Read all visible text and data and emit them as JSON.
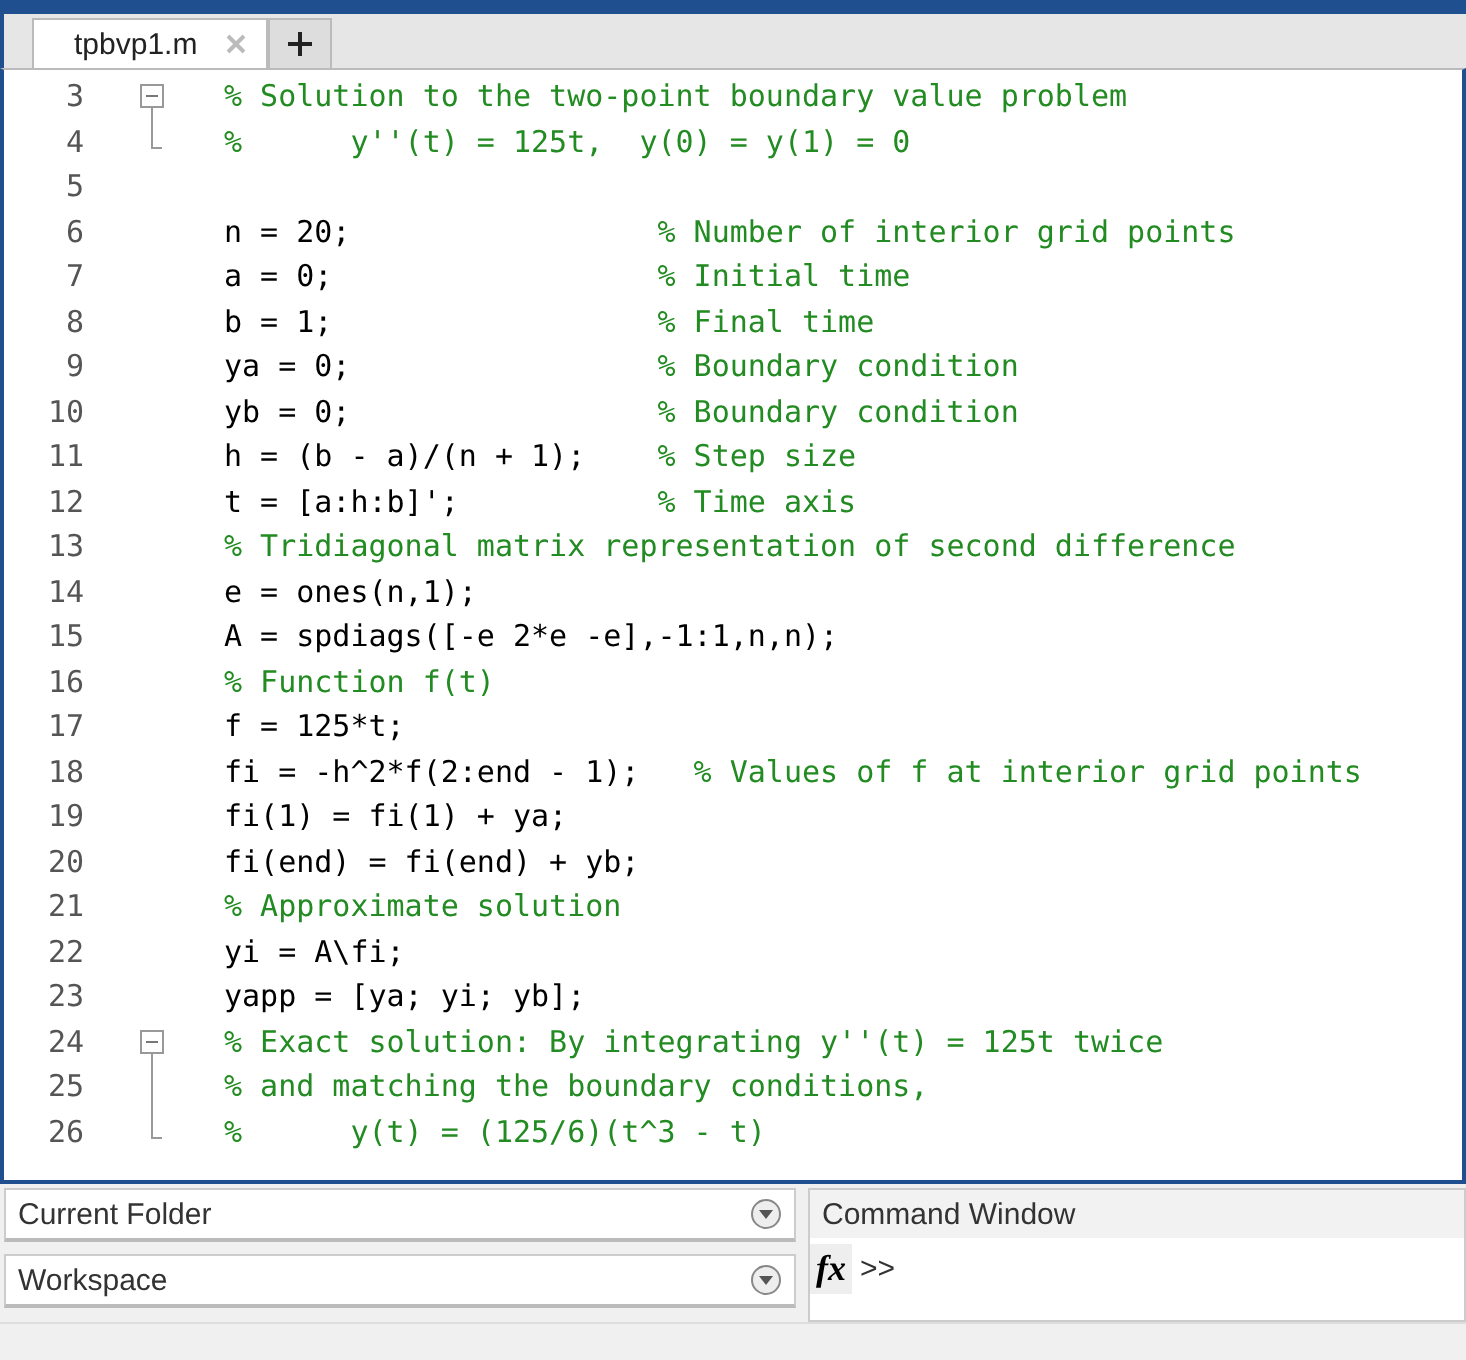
{
  "tabs": [
    {
      "label": "tpbvp1.m",
      "selected": true
    }
  ],
  "editor": {
    "lines": [
      {
        "number": "3",
        "kind": "fold_start",
        "comment": "% Solution to the two-point boundary value problem"
      },
      {
        "number": "4",
        "kind": "fold_end",
        "comment": "%      y''(t) = 125t,  y(0) = y(1) = 0"
      },
      {
        "number": "5"
      },
      {
        "number": "6",
        "code": "n = 20;",
        "comment": "% Number of interior grid points"
      },
      {
        "number": "7",
        "code": "a = 0;",
        "comment": "% Initial time"
      },
      {
        "number": "8",
        "code": "b = 1;",
        "comment": "% Final time"
      },
      {
        "number": "9",
        "code": "ya = 0;",
        "comment": "% Boundary condition"
      },
      {
        "number": "10",
        "code": "yb = 0;",
        "comment": "% Boundary condition"
      },
      {
        "number": "11",
        "code": "h = (b - a)/(n + 1);",
        "comment": "% Step size"
      },
      {
        "number": "12",
        "code": "t = [a:h:b]';",
        "comment": "% Time axis"
      },
      {
        "number": "13",
        "comment": "% Tridiagonal matrix representation of second difference"
      },
      {
        "number": "14",
        "code": "e = ones(n,1);"
      },
      {
        "number": "15",
        "code": "A = spdiags([-e 2*e -e],-1:1,n,n);"
      },
      {
        "number": "16",
        "comment": "% Function f(t)"
      },
      {
        "number": "17",
        "code": "f = 125*t;"
      },
      {
        "number": "18",
        "code": "fi = -h^2*f(2:end - 1);",
        "comment": "% Values of f at interior grid points"
      },
      {
        "number": "19",
        "code": "fi(1) = fi(1) + ya;"
      },
      {
        "number": "20",
        "code": "fi(end) = fi(end) + yb;"
      },
      {
        "number": "21",
        "comment": "% Approximate solution"
      },
      {
        "number": "22",
        "code": "yi = A\\fi;"
      },
      {
        "number": "23",
        "code": "yapp = [ya; yi; yb];"
      },
      {
        "number": "24",
        "kind": "fold_start",
        "comment": "% Exact solution: By integrating y''(t) = 125t twice"
      },
      {
        "number": "25",
        "kind": "fold_inside",
        "comment": "% and matching the boundary conditions,"
      },
      {
        "number": "26",
        "kind": "fold_end",
        "comment": "%      y(t) = (125/6)(t^3 - t)"
      }
    ]
  },
  "panels": [
    {
      "title": "Current Folder"
    },
    {
      "title": "Workspace"
    }
  ],
  "command_window": {
    "title": "Command Window",
    "fx": "fx",
    "prompt": ">>"
  }
}
